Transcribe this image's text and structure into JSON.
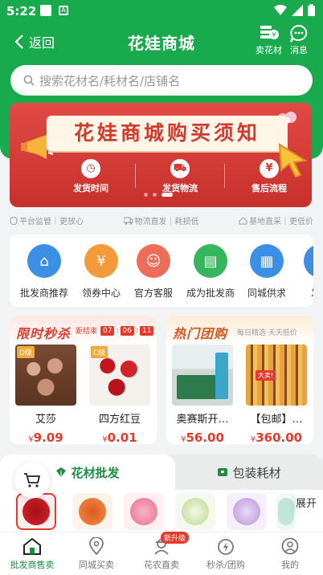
{
  "status_bar": {
    "time": "5:22"
  },
  "header": {
    "back_label": "返回",
    "title": "花娃商城",
    "actions": [
      {
        "label": "卖花材",
        "icon": "sell-flower-icon"
      },
      {
        "label": "消息",
        "icon": "message-icon"
      }
    ]
  },
  "search": {
    "placeholder": "搜索花材名/耗材名/店铺名"
  },
  "banner": {
    "title": "花娃商城购买须知",
    "items": [
      {
        "label": "发货时间",
        "icon": "clock-icon"
      },
      {
        "label": "发货物流",
        "icon": "truck-icon"
      },
      {
        "label": "售后流程",
        "icon": "after-sale-icon"
      }
    ],
    "active_slide": 3,
    "slide_count": 3
  },
  "guarantees": [
    "平台监管｜更放心",
    "物流直发｜耗损低",
    "基地直采｜更低价"
  ],
  "categories": [
    {
      "label": "批发商推荐",
      "icon": "shop-icon",
      "color": "#3b8fe5"
    },
    {
      "label": "领券中心",
      "icon": "coupon-icon",
      "color": "#f39a3a"
    },
    {
      "label": "官方客服",
      "icon": "service-icon",
      "color": "#ee6c5a"
    },
    {
      "label": "成为批发商",
      "icon": "wholesaler-icon",
      "color": "#35b55c"
    },
    {
      "label": "同城供求",
      "icon": "city-icon",
      "color": "#3b8fe5"
    },
    {
      "label": "发布",
      "icon": "publish-icon",
      "color": "#3b8fe5"
    }
  ],
  "flash_sale": {
    "title": "限时秒杀",
    "countdown_label": "距结束",
    "countdown": [
      "07",
      "06",
      "11"
    ],
    "products": [
      {
        "name": "艾莎",
        "grade": "D级",
        "currency": "¥",
        "price": "9.09"
      },
      {
        "name": "四方红豆",
        "grade": "C级",
        "currency": "¥",
        "price": "0.01"
      }
    ]
  },
  "group_buy": {
    "title": "热门团购",
    "subtitle": "每日精选·天天低价",
    "products": [
      {
        "name": "奥赛斯开…",
        "currency": "¥",
        "price": "56.00"
      },
      {
        "name": "【包邮】…",
        "currency": "¥",
        "price": "360.00"
      }
    ]
  },
  "tabs": [
    {
      "label": "花材批发",
      "icon": "flower-icon",
      "active": true
    },
    {
      "label": "包装耗材",
      "icon": "package-icon",
      "active": false
    }
  ],
  "flower_strip": {
    "expand_label": "展开",
    "colors": [
      "#d8232a",
      "#f07a3a",
      "#e9708e",
      "#b9d98a",
      "#b994d9",
      "#bfe6d9"
    ]
  },
  "bottom_nav": [
    {
      "label": "批发商售卖",
      "icon": "home-icon",
      "active": true
    },
    {
      "label": "同城买卖",
      "icon": "location-icon",
      "active": false
    },
    {
      "label": "花农直卖",
      "icon": "farmer-icon",
      "active": false,
      "badge": "新升级"
    },
    {
      "label": "秒杀/团购",
      "icon": "flash-icon",
      "active": false
    },
    {
      "label": "我的",
      "icon": "profile-icon",
      "active": false
    }
  ],
  "colors": {
    "brand_green": "#1aaa4e",
    "accent_red": "#e23b2d"
  }
}
